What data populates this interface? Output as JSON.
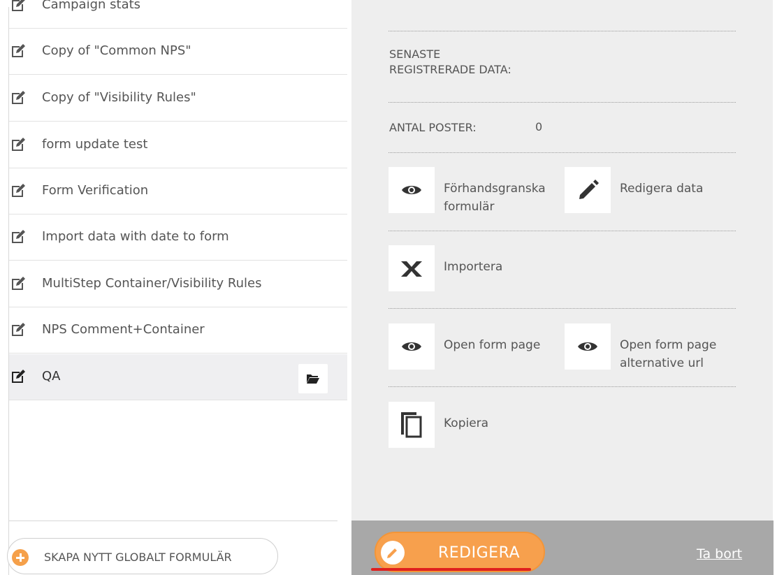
{
  "sidebar": {
    "partial_item_label": "Campaign stats",
    "items": [
      {
        "label": "Copy of \"Common NPS\""
      },
      {
        "label": "Copy of \"Visibility Rules\""
      },
      {
        "label": "form update test"
      },
      {
        "label": "Form Verification"
      },
      {
        "label": "Import data with date to form"
      },
      {
        "label": "MultiStep Container/Visibility Rules"
      },
      {
        "label": "NPS Comment+Container"
      },
      {
        "label": "QA",
        "selected": true
      }
    ],
    "create_button_label": "SKAPA NYTT GLOBALT FORMULÄR"
  },
  "details": {
    "last_data_label": "SENASTE\nREGISTRERADE DATA:",
    "records_label": "ANTAL POSTER:",
    "records_value": "0",
    "actions": {
      "preview": "Förhandsgranska formulär",
      "edit_data": "Redigera data",
      "import": "Importera",
      "open_form_page": "Open form page",
      "open_form_page_alt": "Open form page alternative url",
      "copy": "Kopiera"
    }
  },
  "footer": {
    "edit_label": "REDIGERA",
    "delete_label": "Ta bort"
  },
  "colors": {
    "accent": "#f7a04d",
    "highlight_underline": "#e0201e",
    "panel_bg": "#eeeeee",
    "footer_bg": "#a8a8a8"
  }
}
